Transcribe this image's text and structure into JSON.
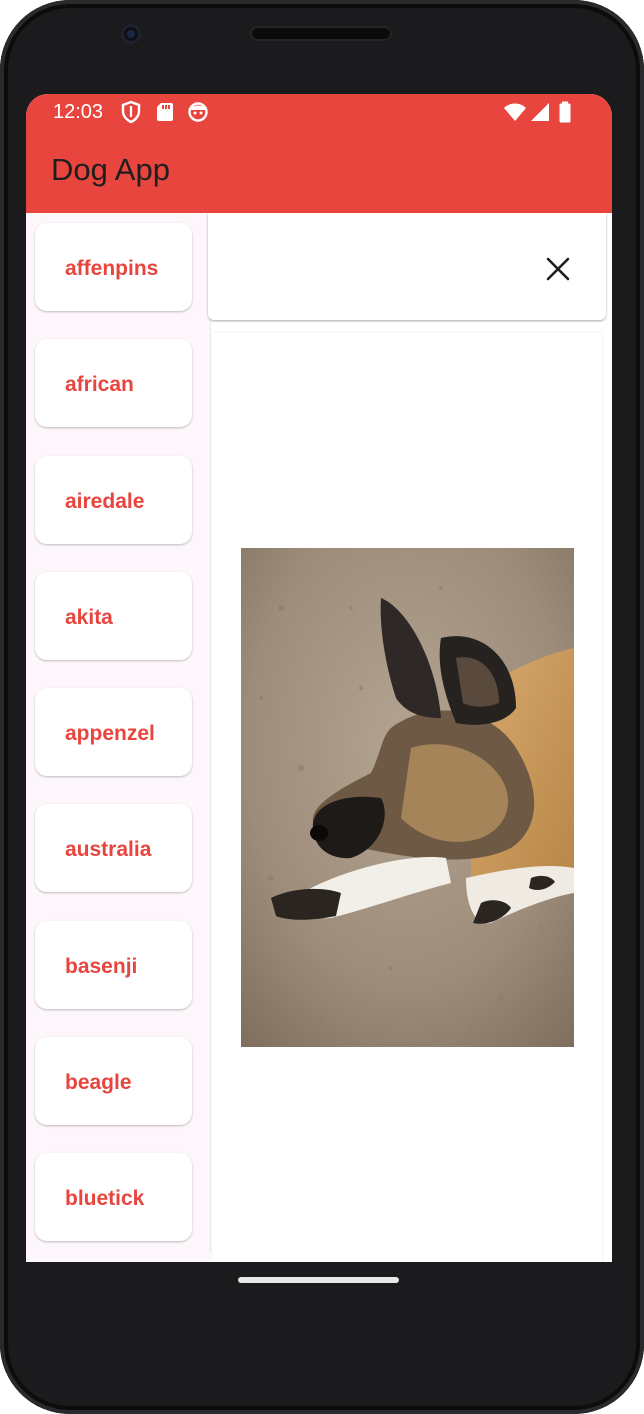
{
  "status_bar": {
    "time": "12:03",
    "left_icons": [
      "shield-icon",
      "sd-card-icon",
      "face-icon"
    ],
    "right_icons": [
      "wifi-icon",
      "cell-signal-icon",
      "battery-icon"
    ]
  },
  "app_bar": {
    "title": "Dog App"
  },
  "breeds": [
    {
      "label": "affenpins"
    },
    {
      "label": "african"
    },
    {
      "label": "airedale"
    },
    {
      "label": "akita"
    },
    {
      "label": "appenzel"
    },
    {
      "label": "australia"
    },
    {
      "label": "basenji"
    },
    {
      "label": "beagle"
    },
    {
      "label": "bluetick"
    }
  ],
  "detail": {
    "close_icon": "close-icon",
    "image": "african-wild-dog-photo"
  },
  "colors": {
    "accent": "#e8453e",
    "title_text": "#1e1e1e",
    "sidebar_bg": "#fdf7fc"
  }
}
